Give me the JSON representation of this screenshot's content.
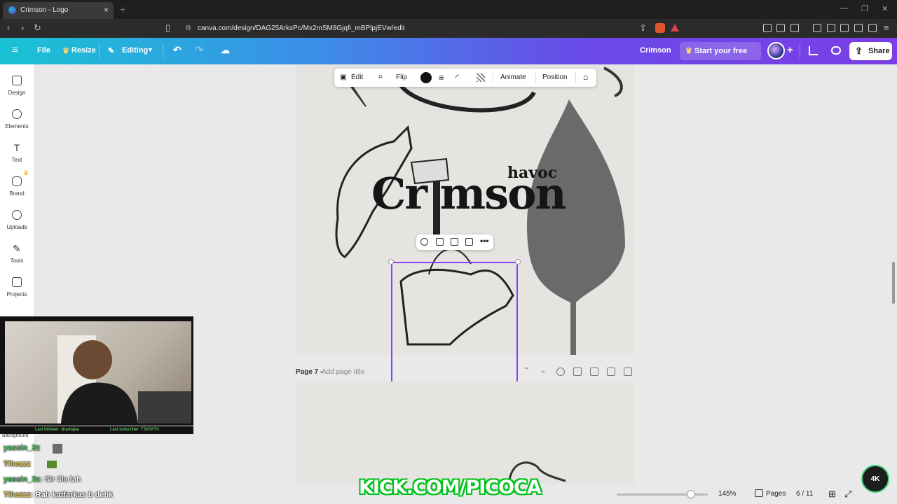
{
  "browser": {
    "tab_title": "Crimson - Logo",
    "tab_close": "×",
    "new_tab": "+",
    "url": "canva.com/design/DAG25ArkxPc/Mx2mSM8Gjqfi_mBPlpjEVw/edit"
  },
  "header": {
    "file": "File",
    "resize": "Resize",
    "editing": "Editing",
    "design_title": "Crimson",
    "trial": "Start your free trial",
    "share": "Share"
  },
  "sidebar": {
    "items": [
      {
        "label": "Design",
        "icon": "design-icon"
      },
      {
        "label": "Elements",
        "icon": "elements-icon"
      },
      {
        "label": "Text",
        "icon": "text-icon"
      },
      {
        "label": "Brand",
        "icon": "brand-icon"
      },
      {
        "label": "Uploads",
        "icon": "uploads-icon"
      },
      {
        "label": "Tools",
        "icon": "tools-icon"
      },
      {
        "label": "Projects",
        "icon": "projects-icon"
      }
    ],
    "background_label": "Background"
  },
  "toolbar": {
    "edit": "Edit",
    "flip": "Flip",
    "animate": "Animate",
    "position": "Position",
    "color": "#111111"
  },
  "canvas": {
    "logo_word": "Cr mson",
    "logo_small": "havoc",
    "page7_label": "Page 7 - ",
    "page7_placeholder": "Add page title"
  },
  "overlay": {
    "follow_text": "Last follower: shamajka",
    "sub_text": "Last subscriber: T3V0XTV",
    "chat": [
      {
        "user": "yassin_3z",
        "msg": ""
      },
      {
        "user": "Tihezzz",
        "msg": ""
      },
      {
        "user": "yassin_3z",
        "msg": ": Sir 3la lah"
      },
      {
        "user": "Tihezzz",
        "msg": ": Rah katfarkas b dehk"
      }
    ],
    "kick_url": "KICK.COM/PICOCA",
    "badge": "4K"
  },
  "footer": {
    "zoom": "145%",
    "pages_label": "Pages",
    "page_count": "6 / 11"
  },
  "colors": {
    "accent": "#8b3dff",
    "header_start": "#19c3d3",
    "header_end": "#7b3fe4"
  }
}
